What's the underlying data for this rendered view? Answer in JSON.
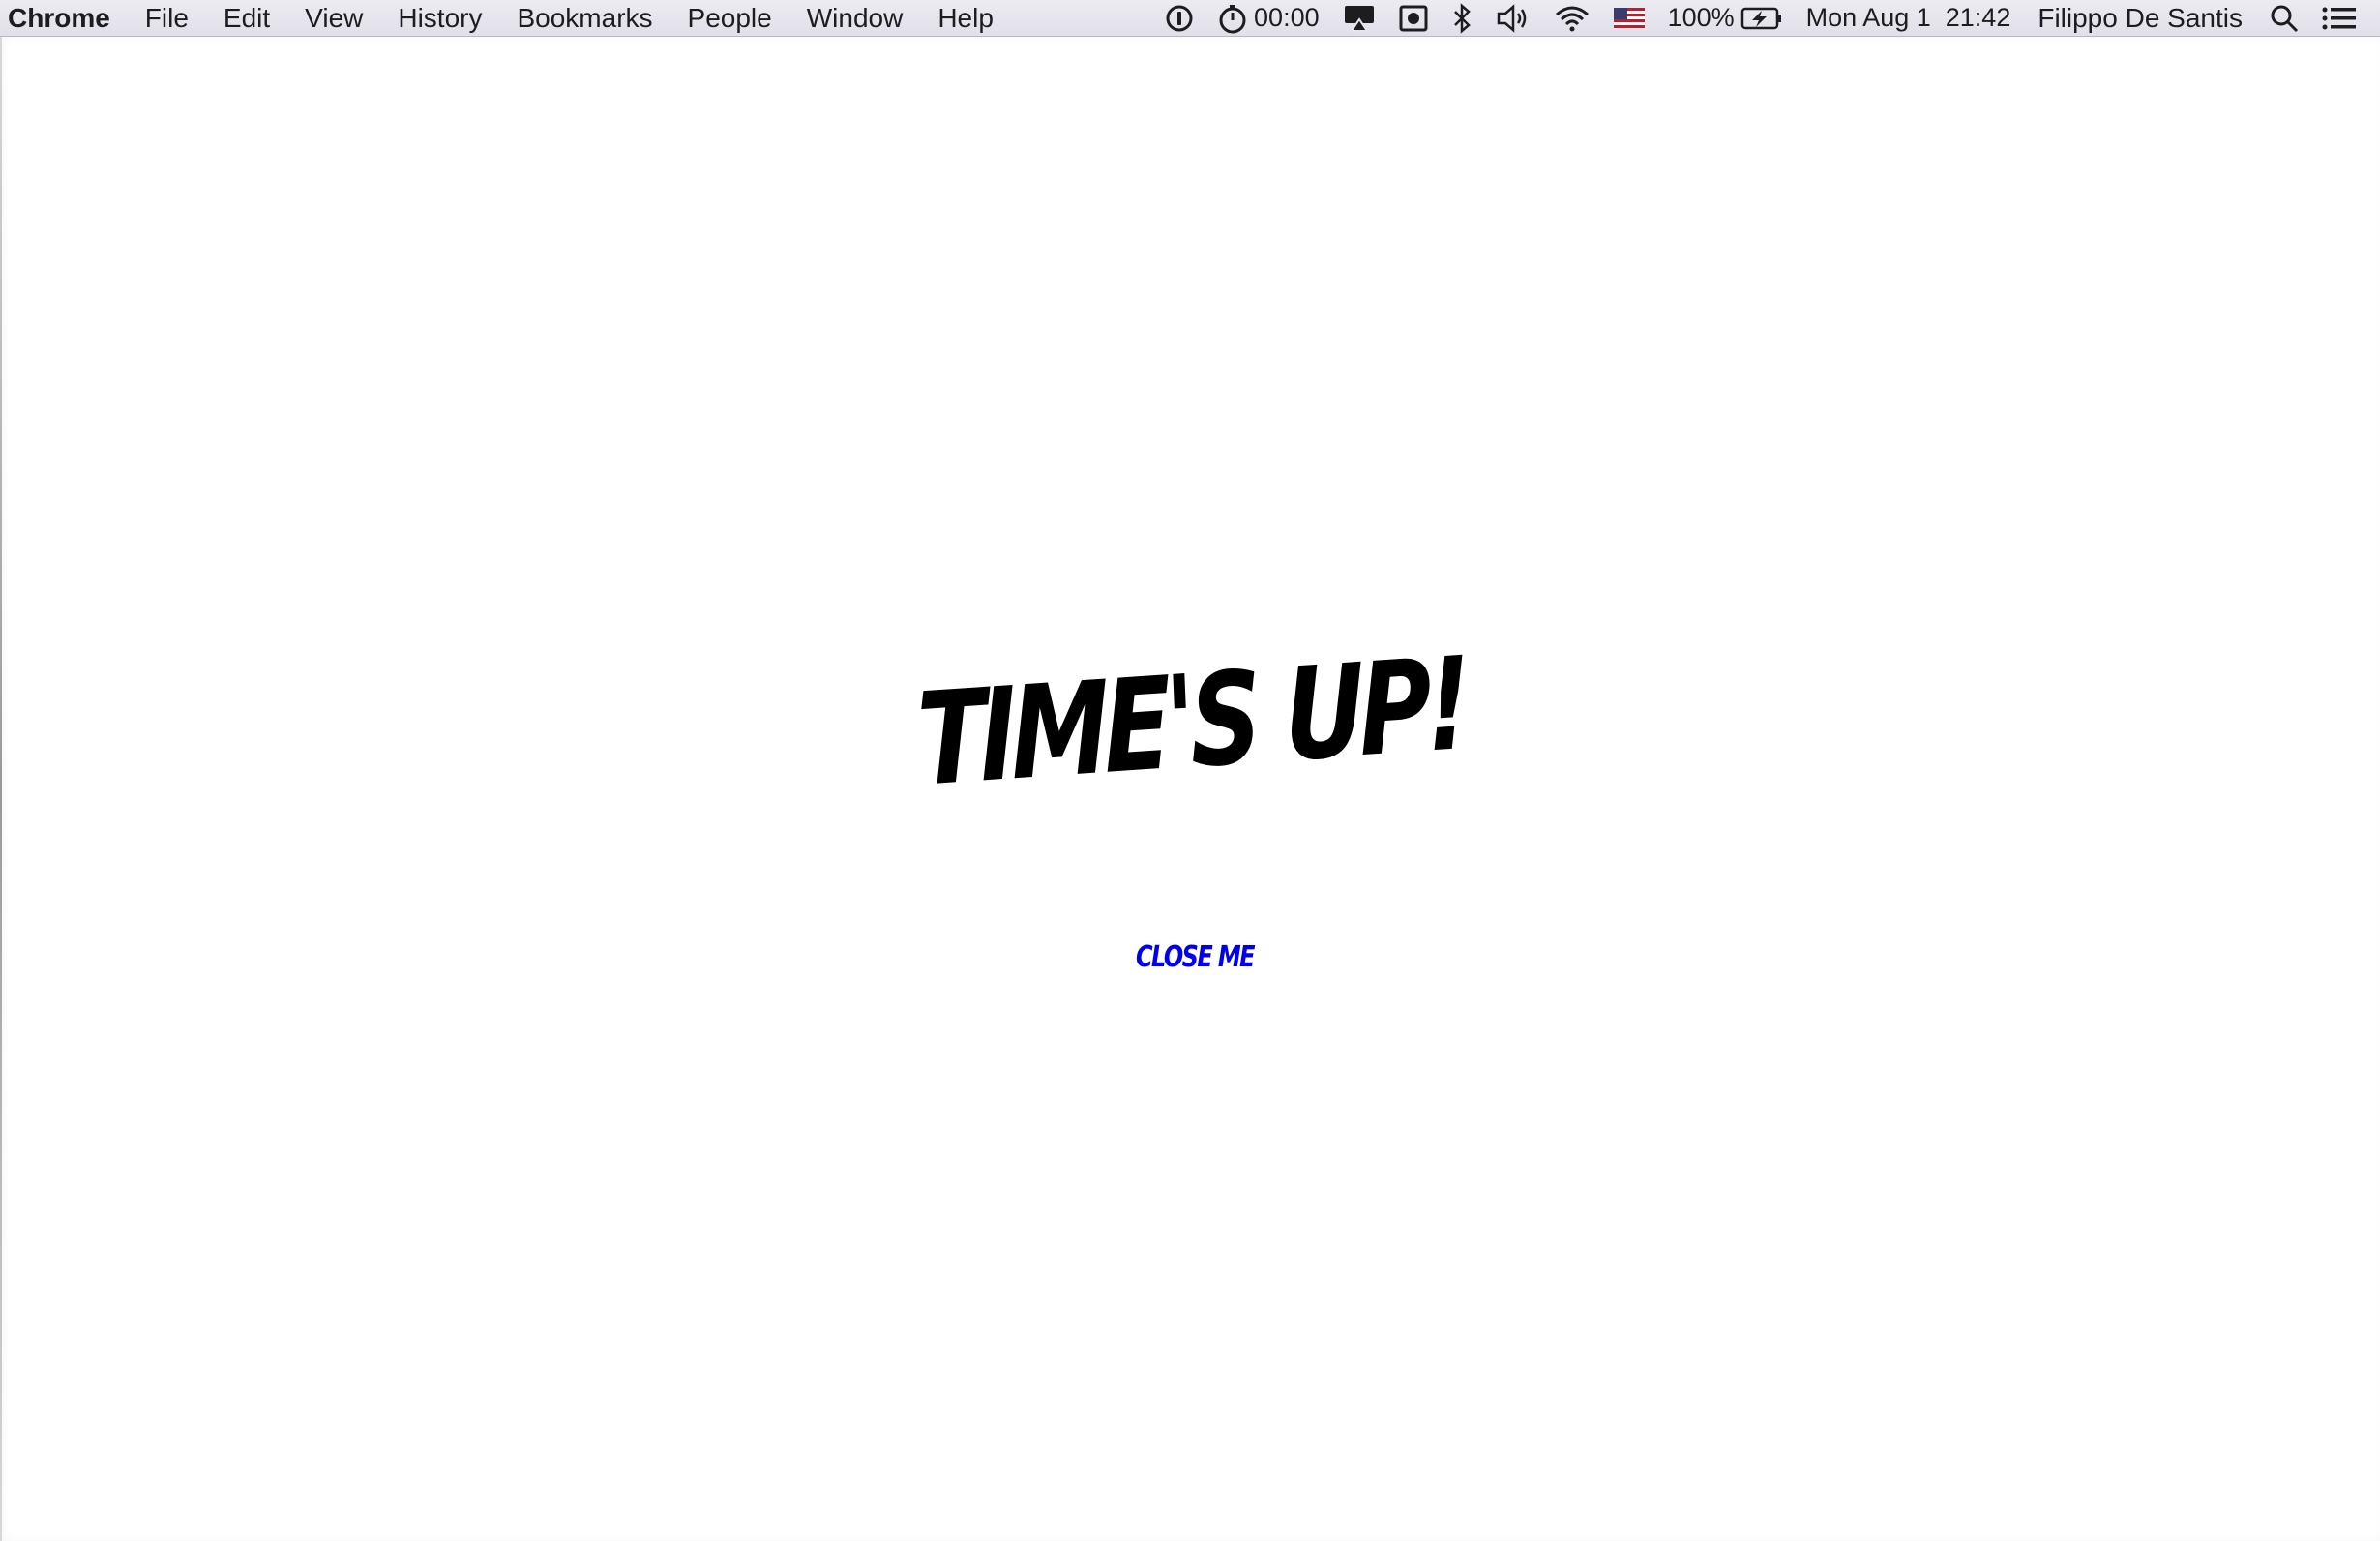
{
  "menubar": {
    "app_name": "Chrome",
    "items": [
      "File",
      "Edit",
      "View",
      "History",
      "Bookmarks",
      "People",
      "Window",
      "Help"
    ],
    "timer": "00:00",
    "battery": "100%",
    "datetime": "Mon Aug 1  21:42",
    "user": "Filippo De Santis",
    "icons": [
      "1password-icon",
      "stopwatch-icon",
      "airplay-icon",
      "screen-record-icon",
      "bluetooth-icon",
      "volume-icon",
      "wifi-icon",
      "us-flag-icon",
      "battery-charging-icon",
      "spotlight-search-icon",
      "notification-center-icon"
    ]
  },
  "page": {
    "headline": "TIME'S UP!",
    "close_label": "CLOSE ME"
  },
  "colors": {
    "headline": "#000000",
    "link": "#0000ee",
    "background": "#ffffff"
  }
}
